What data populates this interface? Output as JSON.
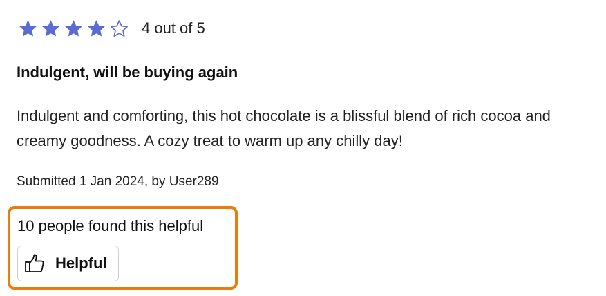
{
  "rating": {
    "value": 4,
    "max": 5,
    "text": "4 out of 5",
    "star_color": "#5b6bd6"
  },
  "review": {
    "title": "Indulgent, will be buying again",
    "body": "Indulgent and comforting, this hot chocolate is a blissful blend of rich cocoa and creamy goodness. A cozy treat to warm up any chilly day!",
    "submitted": "Submitted 1 Jan 2024, by User289"
  },
  "helpful": {
    "count_text": "10 people found this helpful",
    "button_label": "Helpful",
    "button_icon": "thumbs-up-icon",
    "highlight_color": "#e87d0d"
  }
}
